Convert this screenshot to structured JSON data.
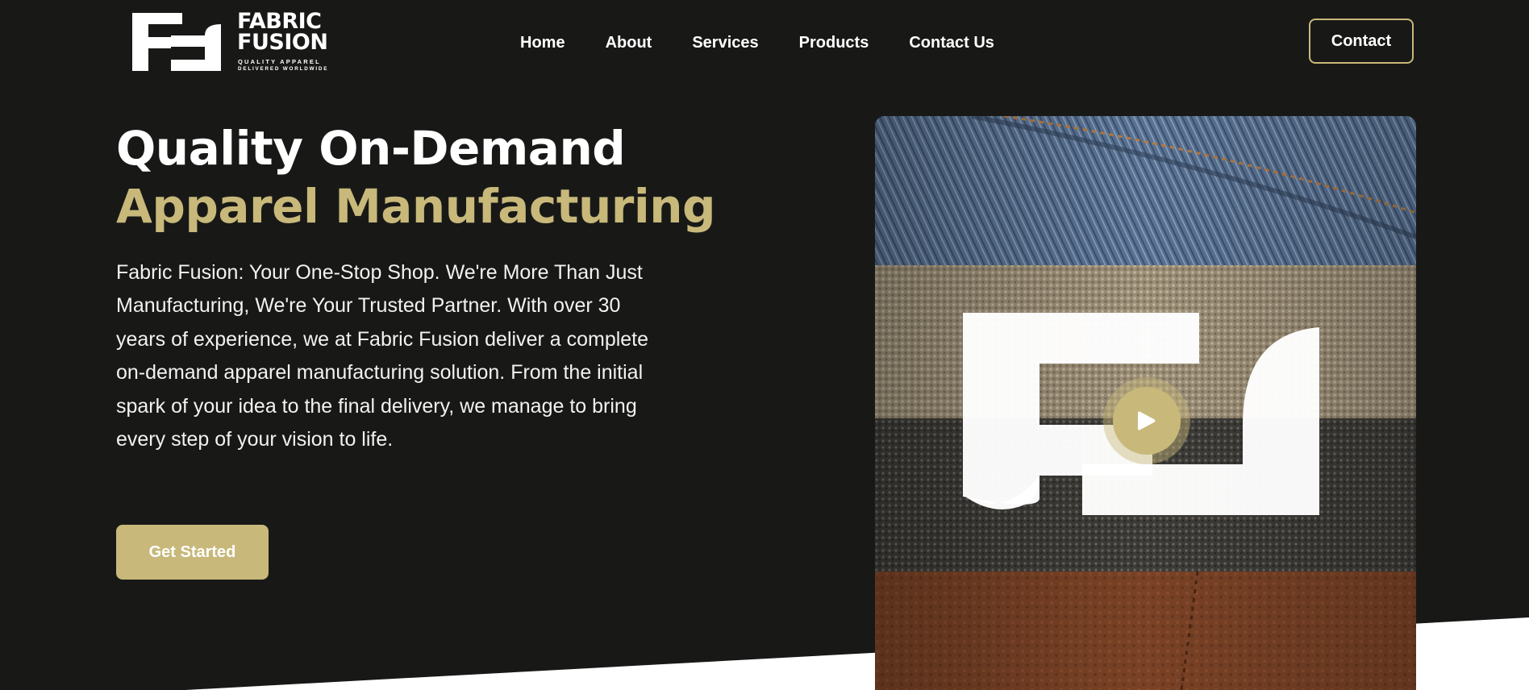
{
  "brand": {
    "name_line1": "FABRIC",
    "name_line2": "FUSION",
    "tagline_line1": "QUALITY APPAREL",
    "tagline_line2": "DELIVERED WORLDWIDE"
  },
  "nav": {
    "items": [
      {
        "label": "Home"
      },
      {
        "label": "About"
      },
      {
        "label": "Services"
      },
      {
        "label": "Products"
      },
      {
        "label": "Contact Us"
      }
    ],
    "contact_button": "Contact"
  },
  "hero": {
    "title_line1": "Quality On-Demand",
    "title_line2": "Apparel Manufacturing",
    "description": "Fabric Fusion: Your One-Stop Shop. We're More Than Just Manufacturing, We're Your Trusted Partner. With over 30 years of experience, we at Fabric Fusion deliver a complete on-demand apparel manufacturing solution. From the initial spark of your idea to the final delivery, we manage to bring every step of your vision to life.",
    "cta_label": "Get Started"
  },
  "media": {
    "fabrics": [
      "denim",
      "beige-fleece",
      "charcoal-knit",
      "brown-suede"
    ],
    "play_icon": "play-icon"
  },
  "colors": {
    "background": "#181917",
    "accent": "#c8b87a",
    "text": "#ffffff"
  }
}
